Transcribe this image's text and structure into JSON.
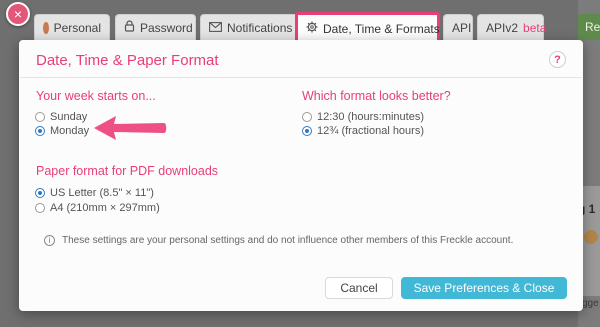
{
  "background": {
    "right_button_label": "Re",
    "right_card_text": "g 1",
    "right_small_text": "gge"
  },
  "tabs": [
    {
      "label": "Personal",
      "icon": "avatar"
    },
    {
      "label": "Password",
      "icon": "lock-icon"
    },
    {
      "label": "Notifications",
      "icon": "envelope-icon"
    },
    {
      "label": "Date, Time & Formats",
      "icon": "gear-icon",
      "active": true
    },
    {
      "label": "API"
    },
    {
      "label": "APIv2",
      "badge": "beta"
    }
  ],
  "modal": {
    "title": "Date, Time & Paper Format",
    "help_label": "?",
    "close_label": "×",
    "week_section": {
      "heading": "Your week starts on...",
      "options": [
        {
          "label": "Sunday",
          "selected": false
        },
        {
          "label": "Monday",
          "selected": true
        }
      ]
    },
    "time_section": {
      "heading": "Which format looks better?",
      "options": [
        {
          "label": "12:30 (hours:minutes)",
          "selected": false
        },
        {
          "label": "12¾ (fractional hours)",
          "selected": true
        }
      ]
    },
    "paper_section": {
      "heading": "Paper format for PDF downloads",
      "options": [
        {
          "label": "US Letter (8.5\" × 11\")",
          "selected": true
        },
        {
          "label": "A4 (210mm × 297mm)",
          "selected": false
        }
      ]
    },
    "info_text": "These settings are your personal settings and do not influence other members of this Freckle account.",
    "cancel_label": "Cancel",
    "save_label": "Save Preferences & Close"
  },
  "colors": {
    "accent": "#e83e7a",
    "primary_button": "#41b8d6",
    "radio_selected": "#2f7bbf"
  }
}
